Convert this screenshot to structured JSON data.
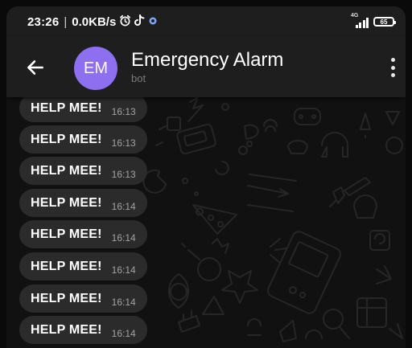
{
  "status_bar": {
    "time": "23:26",
    "separator": "|",
    "network_speed": "0.0KB/s",
    "alarm_icon": "alarm-clock-icon",
    "notification_icon": "tiktok-icon",
    "extra_icon": "vpn-dot-icon",
    "network_type": "4G",
    "signal_icon": "signal-bars-icon",
    "battery_level": "65"
  },
  "header": {
    "back_icon": "arrow-left-icon",
    "avatar_initials": "EM",
    "avatar_color": "#8e6ff0",
    "title": "Emergency Alarm",
    "subtitle": "bot",
    "menu_icon": "more-vertical-icon"
  },
  "messages": [
    {
      "text": "HELP MEE!",
      "time": "16:13"
    },
    {
      "text": "HELP MEE!",
      "time": "16:13"
    },
    {
      "text": "HELP MEE!",
      "time": "16:13"
    },
    {
      "text": "HELP MEE!",
      "time": "16:14"
    },
    {
      "text": "HELP MEE!",
      "time": "16:14"
    },
    {
      "text": "HELP MEE!",
      "time": "16:14"
    },
    {
      "text": "HELP MEE!",
      "time": "16:14"
    },
    {
      "text": "HELP MEE!",
      "time": "16:14"
    }
  ],
  "theme": {
    "bubble_color": "#2b2b2b",
    "header_color": "#1e1e1e",
    "wallpaper_color": "#111111",
    "doodle_color": "#262626"
  }
}
